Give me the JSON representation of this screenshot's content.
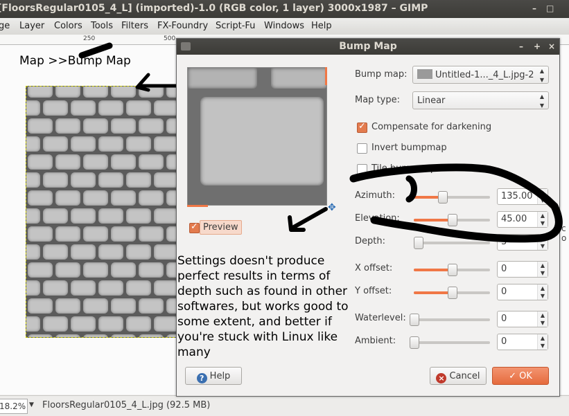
{
  "window": {
    "title": "[FloorsRegular0105_4_L] (imported)-1.0 (RGB color, 1 layer) 3000x1987 – GIMP",
    "controls": [
      "–",
      "□"
    ]
  },
  "menu": [
    "ge",
    "Layer",
    "Colors",
    "Tools",
    "Filters",
    "FX-Foundry",
    "Script-Fu",
    "Windows",
    "Help"
  ],
  "ruler": {
    "ticks": [
      "250",
      "500"
    ]
  },
  "status": {
    "zoom": "18.2%",
    "file": "FloorsRegular0105_4_L.jpg (92.5 MB)"
  },
  "annotations": {
    "menu_path": "Map >>Bump Map",
    "comment": "Settings doesn't produce perfect results in terms of depth such as found in other softwares, but works good to some extent, and better if you're stuck with Linux like many"
  },
  "dialog": {
    "title": "Bump Map",
    "controls": [
      "–",
      "+",
      "×"
    ],
    "preview_label": "Preview",
    "preview_checked": true,
    "bump_map_label": "Bump map:",
    "bump_map_value": "Untitled-1..._4_L.jpg-2",
    "map_type_label": "Map type:",
    "map_type_value": "Linear",
    "checkboxes": [
      {
        "label": "Compensate for darkening",
        "checked": true
      },
      {
        "label": "Invert bumpmap",
        "checked": false
      },
      {
        "label": "Tile bumpmap",
        "checked": false
      }
    ],
    "sliders": [
      {
        "label": "Azimuth:",
        "value": "135.00",
        "fraction": 0.375
      },
      {
        "label": "Elevation:",
        "value": "45.00",
        "fraction": 0.5
      },
      {
        "label": "Depth:",
        "value": "3",
        "fraction": 0.05
      },
      {
        "label": "X offset:",
        "value": "0",
        "fraction": 0.5
      },
      {
        "label": "Y offset:",
        "value": "0",
        "fraction": 0.5
      },
      {
        "label": "Waterlevel:",
        "value": "0",
        "fraction": 0.0
      },
      {
        "label": "Ambient:",
        "value": "0",
        "fraction": 0.0
      }
    ],
    "buttons": {
      "help": "Help",
      "cancel": "Cancel",
      "ok": "OK"
    }
  },
  "colors": {
    "accent": "#f07746",
    "titlebar": "#3c3b37"
  }
}
